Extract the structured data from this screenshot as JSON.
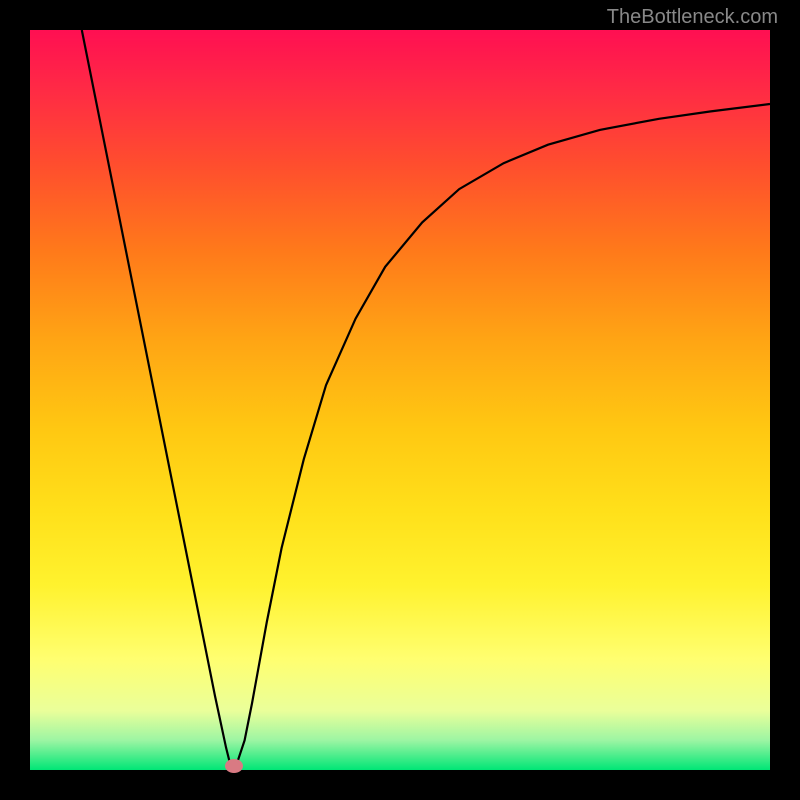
{
  "attribution": "TheBottleneck.com",
  "chart_data": {
    "type": "line",
    "title": "",
    "xlabel": "",
    "ylabel": "",
    "xlim": [
      0,
      100
    ],
    "ylim": [
      0,
      100
    ],
    "background_gradient": {
      "direction": "vertical",
      "stops": [
        {
          "pos": 0,
          "color": "#ff0f52"
        },
        {
          "pos": 8,
          "color": "#ff2a45"
        },
        {
          "pos": 18,
          "color": "#ff4d2e"
        },
        {
          "pos": 30,
          "color": "#ff7a1a"
        },
        {
          "pos": 42,
          "color": "#ffa514"
        },
        {
          "pos": 54,
          "color": "#ffc812"
        },
        {
          "pos": 65,
          "color": "#ffe01a"
        },
        {
          "pos": 75,
          "color": "#fff22e"
        },
        {
          "pos": 85,
          "color": "#ffff70"
        },
        {
          "pos": 92,
          "color": "#eaff9a"
        },
        {
          "pos": 96,
          "color": "#9cf5a3"
        },
        {
          "pos": 100,
          "color": "#00e676"
        }
      ]
    },
    "series": [
      {
        "name": "curve",
        "color": "#000000",
        "points": [
          {
            "x": 7.0,
            "y": 100.0
          },
          {
            "x": 9.0,
            "y": 90.0
          },
          {
            "x": 11.0,
            "y": 80.0
          },
          {
            "x": 13.0,
            "y": 70.0
          },
          {
            "x": 15.0,
            "y": 60.0
          },
          {
            "x": 17.0,
            "y": 50.0
          },
          {
            "x": 19.0,
            "y": 40.0
          },
          {
            "x": 21.0,
            "y": 30.0
          },
          {
            "x": 23.0,
            "y": 20.0
          },
          {
            "x": 25.0,
            "y": 10.0
          },
          {
            "x": 26.5,
            "y": 3.0
          },
          {
            "x": 27.0,
            "y": 1.0
          },
          {
            "x": 27.5,
            "y": 0.5
          },
          {
            "x": 28.0,
            "y": 1.0
          },
          {
            "x": 29.0,
            "y": 4.0
          },
          {
            "x": 30.0,
            "y": 9.0
          },
          {
            "x": 32.0,
            "y": 20.0
          },
          {
            "x": 34.0,
            "y": 30.0
          },
          {
            "x": 37.0,
            "y": 42.0
          },
          {
            "x": 40.0,
            "y": 52.0
          },
          {
            "x": 44.0,
            "y": 61.0
          },
          {
            "x": 48.0,
            "y": 68.0
          },
          {
            "x": 53.0,
            "y": 74.0
          },
          {
            "x": 58.0,
            "y": 78.5
          },
          {
            "x": 64.0,
            "y": 82.0
          },
          {
            "x": 70.0,
            "y": 84.5
          },
          {
            "x": 77.0,
            "y": 86.5
          },
          {
            "x": 85.0,
            "y": 88.0
          },
          {
            "x": 92.0,
            "y": 89.0
          },
          {
            "x": 100.0,
            "y": 90.0
          }
        ]
      }
    ],
    "marker": {
      "x": 27.5,
      "y": 0.5,
      "color": "#d97a83"
    }
  }
}
